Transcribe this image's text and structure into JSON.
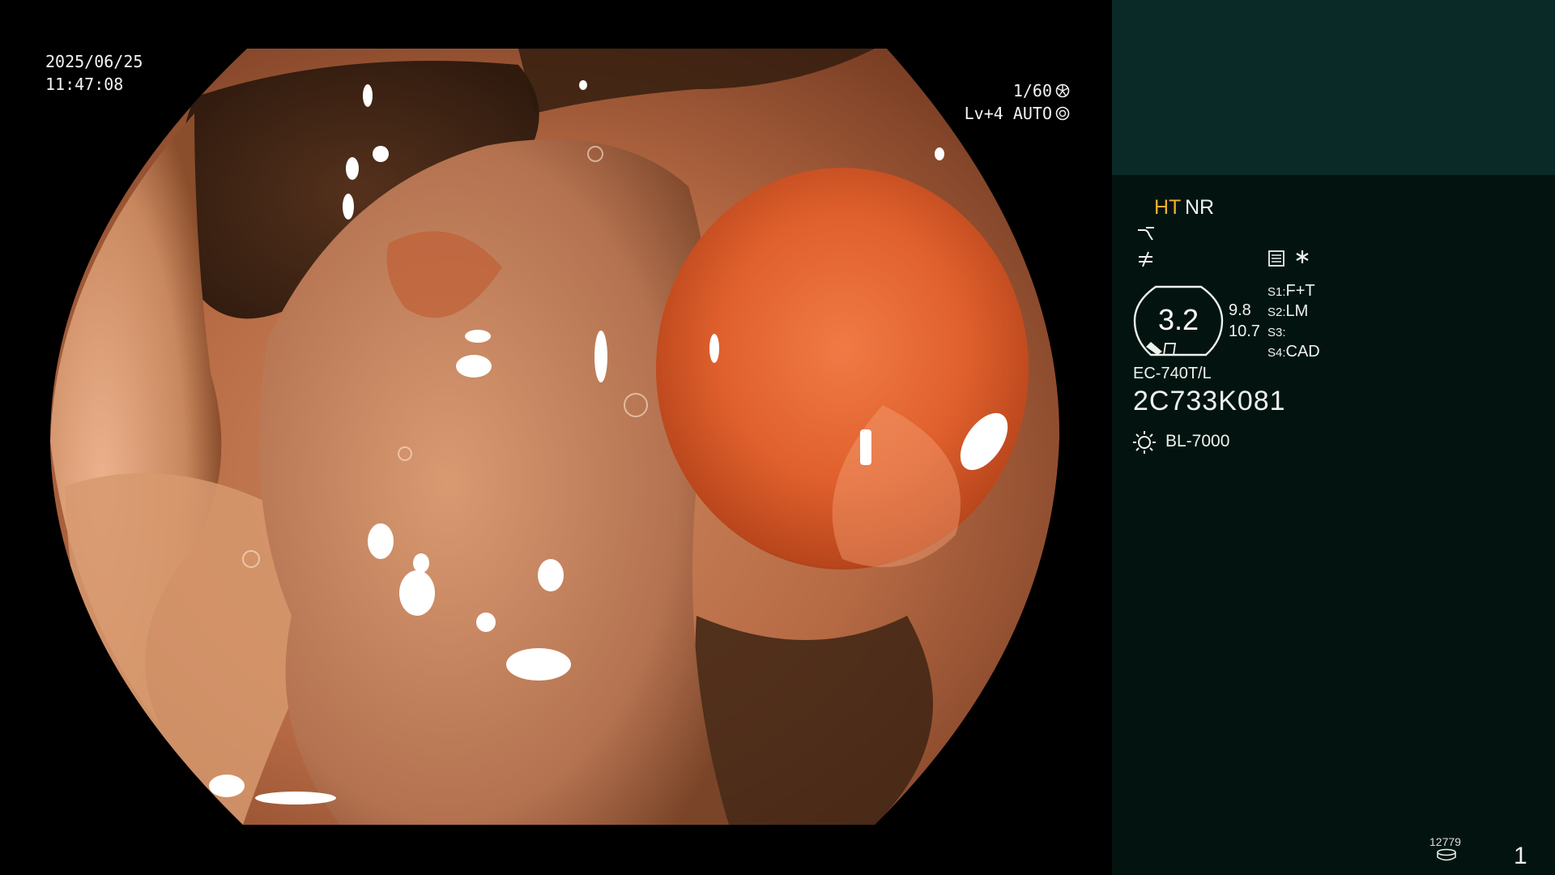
{
  "osd": {
    "date": "2025/06/25",
    "time": "11:47:08",
    "shutter": "1/60",
    "level": "Lv+4 AUTO"
  },
  "panel": {
    "mode_ht": "HT",
    "mode_nr": "NR",
    "zoom": {
      "value": "3.2",
      "n1": "9.8",
      "n2": "10.7"
    },
    "settings": [
      {
        "key": "S1:",
        "value": "F+T"
      },
      {
        "key": "S2:",
        "value": "LM"
      },
      {
        "key": "S3:",
        "value": ""
      },
      {
        "key": "S4:",
        "value": "CAD"
      }
    ],
    "model": "EC-740T/L",
    "serial": "2C733K081",
    "light_source": "BL-7000",
    "counter": "12779",
    "page": "1"
  },
  "icons": {
    "shutter": "aperture-icon",
    "auto": "auto-exposure-icon",
    "wave": "enhancement-curve-icon",
    "notequal": "not-equal-icon",
    "list": "memo-icon",
    "star": "asterisk-icon",
    "light": "light-source-icon",
    "counter": "storage-disk-icon"
  },
  "colors": {
    "panel_top": "#0a2a27",
    "panel_bg": "#031410",
    "ht_label": "#f0b030"
  }
}
